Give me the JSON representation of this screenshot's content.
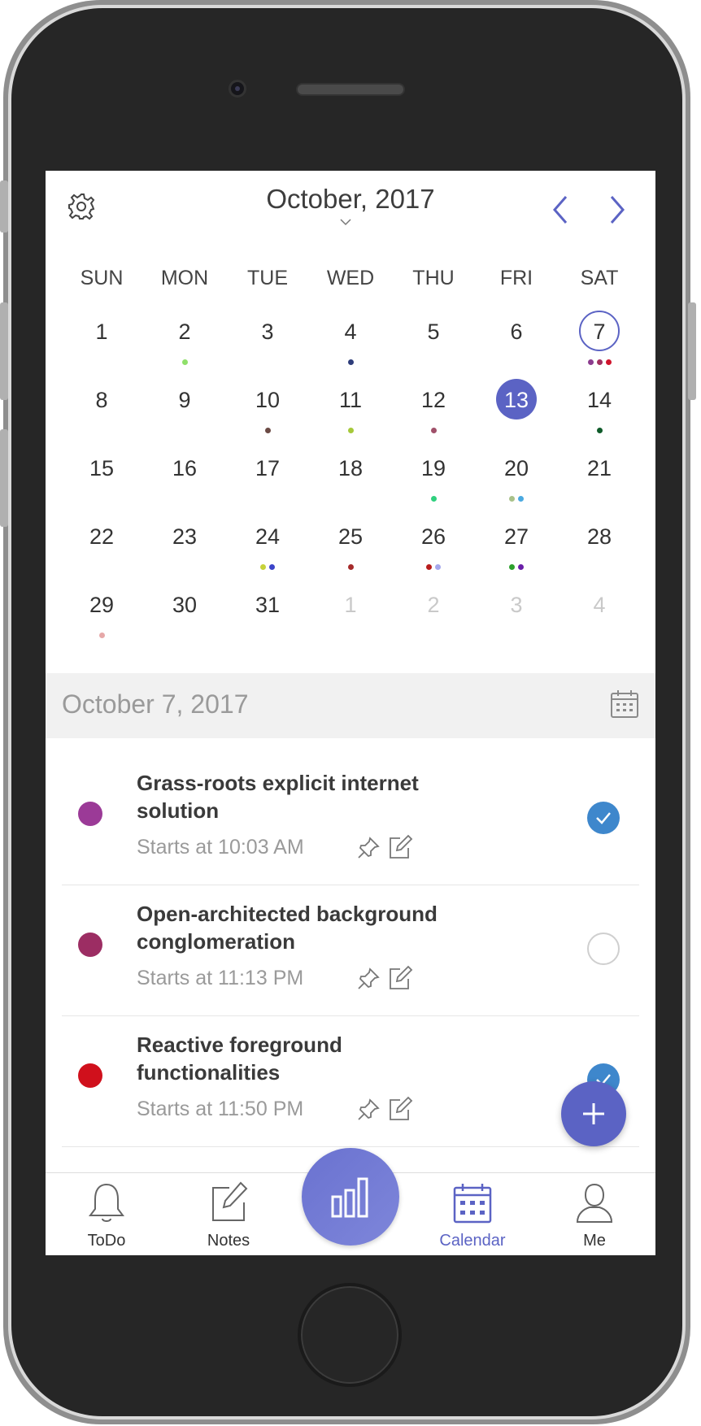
{
  "calendar": {
    "month_title": "October, 2017",
    "weekdays": [
      "SUN",
      "MON",
      "TUE",
      "WED",
      "THU",
      "FRI",
      "SAT"
    ],
    "weeks": [
      [
        {
          "n": "1",
          "dots": []
        },
        {
          "n": "2",
          "dots": [
            "#8fe06a"
          ]
        },
        {
          "n": "3",
          "dots": []
        },
        {
          "n": "4",
          "dots": [
            "#2e3d7a"
          ]
        },
        {
          "n": "5",
          "dots": []
        },
        {
          "n": "6",
          "dots": []
        },
        {
          "n": "7",
          "dots": [
            "#8b3c8e",
            "#a12f5f",
            "#d0142c"
          ],
          "selected": true
        }
      ],
      [
        {
          "n": "8",
          "dots": []
        },
        {
          "n": "9",
          "dots": []
        },
        {
          "n": "10",
          "dots": [
            "#6b4a44"
          ]
        },
        {
          "n": "11",
          "dots": [
            "#a6c93a"
          ]
        },
        {
          "n": "12",
          "dots": [
            "#a0506a"
          ]
        },
        {
          "n": "13",
          "dots": [],
          "today": true
        },
        {
          "n": "14",
          "dots": [
            "#0f5b2a"
          ]
        }
      ],
      [
        {
          "n": "15",
          "dots": []
        },
        {
          "n": "16",
          "dots": []
        },
        {
          "n": "17",
          "dots": []
        },
        {
          "n": "18",
          "dots": []
        },
        {
          "n": "19",
          "dots": [
            "#2fd07e"
          ]
        },
        {
          "n": "20",
          "dots": [
            "#a9c18a",
            "#4aa9e0"
          ]
        },
        {
          "n": "21",
          "dots": []
        }
      ],
      [
        {
          "n": "22",
          "dots": []
        },
        {
          "n": "23",
          "dots": []
        },
        {
          "n": "24",
          "dots": [
            "#c6d23a",
            "#3b44c9"
          ]
        },
        {
          "n": "25",
          "dots": [
            "#a52a2a"
          ]
        },
        {
          "n": "26",
          "dots": [
            "#b81c1c",
            "#a6a8ec"
          ]
        },
        {
          "n": "27",
          "dots": [
            "#2ca02c",
            "#6a1fa8"
          ]
        },
        {
          "n": "28",
          "dots": []
        }
      ],
      [
        {
          "n": "29",
          "dots": [
            "#e6a8a8"
          ]
        },
        {
          "n": "30",
          "dots": []
        },
        {
          "n": "31",
          "dots": []
        },
        {
          "n": "1",
          "dots": [],
          "muted": true
        },
        {
          "n": "2",
          "dots": [],
          "muted": true
        },
        {
          "n": "3",
          "dots": [],
          "muted": true
        },
        {
          "n": "4",
          "dots": [],
          "muted": true
        }
      ]
    ]
  },
  "agenda": {
    "date_label": "October 7, 2017",
    "events": [
      {
        "title": "Grass-roots explicit internet solution",
        "time": "Starts at 10:03 AM",
        "color": "#9b3a97",
        "done": true
      },
      {
        "title": "Open-architected background conglomeration",
        "time": "Starts at 11:13 PM",
        "color": "#9c2d63",
        "done": false
      },
      {
        "title": "Reactive foreground functionalities",
        "time": "Starts at 11:50 PM",
        "color": "#d0101c",
        "done": true
      }
    ]
  },
  "tabbar": {
    "todo": "ToDo",
    "notes": "Notes",
    "calendar": "Calendar",
    "me": "Me"
  },
  "colors": {
    "accent": "#5b63c4",
    "check": "#3e87cc"
  }
}
